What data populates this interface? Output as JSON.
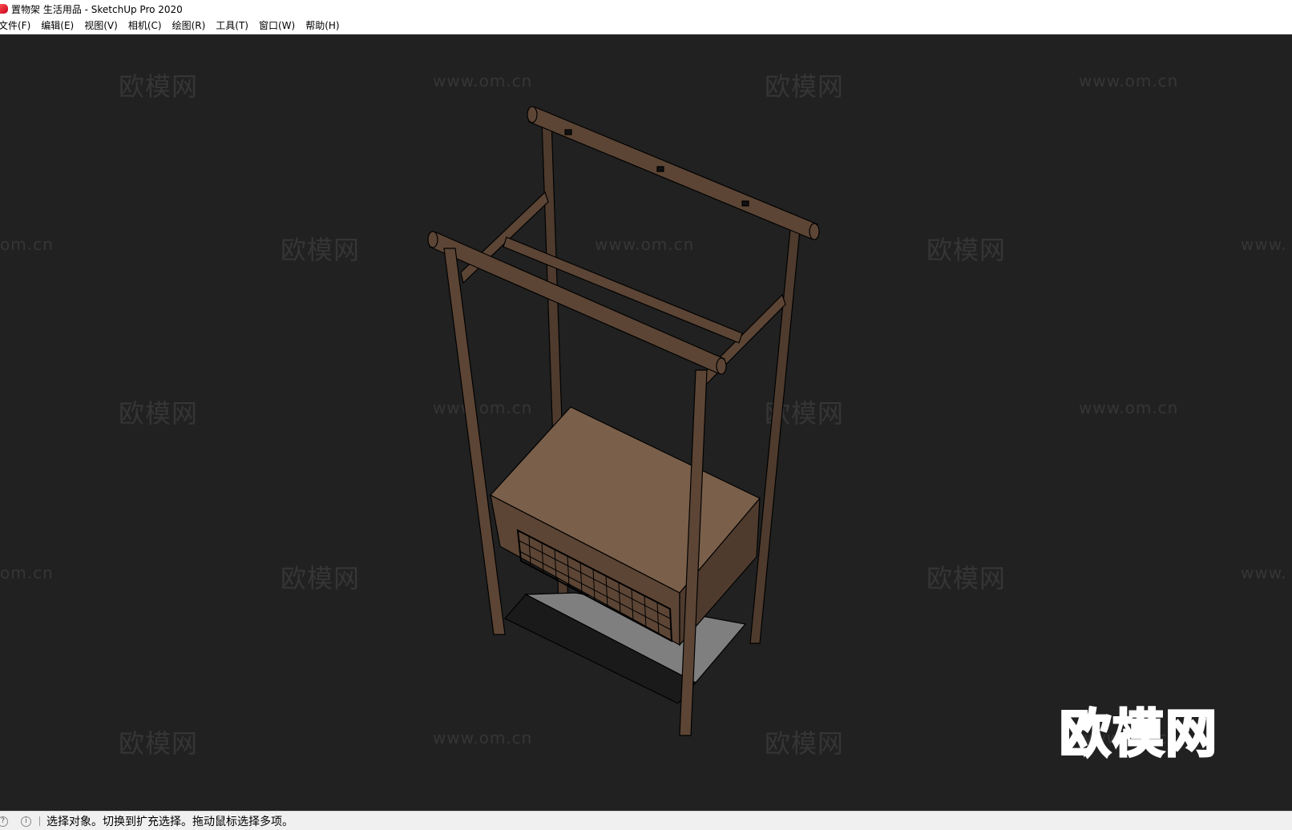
{
  "window": {
    "title": "置物架 生活用品 - SketchUp Pro 2020"
  },
  "menu": [
    "文件(F)",
    "编辑(E)",
    "视图(V)",
    "相机(C)",
    "绘图(R)",
    "工具(T)",
    "窗口(W)",
    "帮助(H)"
  ],
  "watermark": {
    "cn": "欧模网",
    "url": "www.om.cn",
    "url_partial": "om.cn",
    "url_cut": "www."
  },
  "logo": {
    "text": "欧模网"
  },
  "status": {
    "message": "选择对象。切换到扩充选择。拖动鼠标选择多项。",
    "info_glyph": "i",
    "help_glyph": "?"
  },
  "colors": {
    "viewport_bg": "#212121",
    "wood": "#5c4535",
    "shelf_top": "#7a5f4a",
    "basket": "#000000",
    "bottom_shelf": "#8c8c8c"
  },
  "icons": [
    "sketchup-logo-icon",
    "help-icon",
    "info-icon"
  ]
}
